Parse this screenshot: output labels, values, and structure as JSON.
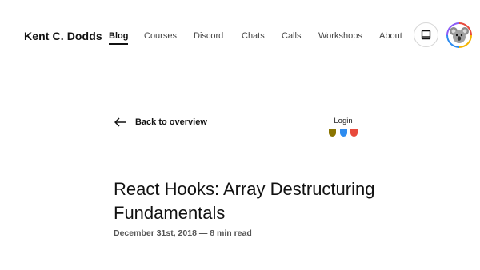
{
  "header": {
    "brand": "Kent C. Dodds",
    "nav": [
      {
        "label": "Blog",
        "active": true
      },
      {
        "label": "Courses",
        "active": false
      },
      {
        "label": "Discord",
        "active": false
      },
      {
        "label": "Chats",
        "active": false
      },
      {
        "label": "Calls",
        "active": false
      },
      {
        "label": "Workshops",
        "active": false
      },
      {
        "label": "About",
        "active": false
      }
    ],
    "theme_toggle_icon": "theme-toggle-icon",
    "avatar_icon": "koala-avatar"
  },
  "back_link": {
    "label": "Back to overview",
    "icon": "arrow-left-icon"
  },
  "login": {
    "label": "Login",
    "team_colors": [
      "#8a7400",
      "#2d8cf0",
      "#e84a3c"
    ]
  },
  "post": {
    "title": "React Hooks: Array Destructuring Fundamentals",
    "meta": "December 31st, 2018 — 8 min read"
  },
  "colors": {
    "text": "#111111",
    "muted": "#555555",
    "border": "#d7d7d7"
  }
}
